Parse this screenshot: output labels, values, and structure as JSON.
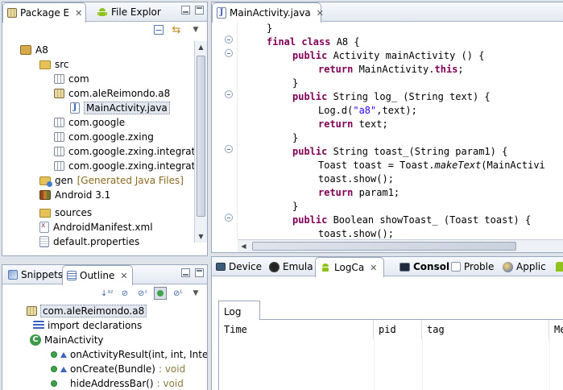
{
  "package_panel": {
    "tabs": [
      {
        "label": "Package E",
        "icon": "package-explorer-icon"
      },
      {
        "label": "File Explor",
        "icon": "android-icon"
      }
    ],
    "tree": [
      {
        "label": "A8",
        "icon": "project-icon",
        "decor": ""
      },
      {
        "label": "src",
        "icon": "source-folder-icon",
        "decor": ""
      },
      {
        "label": "com",
        "icon": "package-icon",
        "decor": ""
      },
      {
        "label": "com.aleReimondo.a8",
        "icon": "package-icon",
        "decor": ""
      },
      {
        "label": "MainActivity.java",
        "icon": "java-file-icon",
        "decor": ""
      },
      {
        "label": "com.google",
        "icon": "package-icon",
        "decor": ""
      },
      {
        "label": "com.google.zxing",
        "icon": "package-icon",
        "decor": ""
      },
      {
        "label": "com.google.zxing.integration",
        "icon": "package-icon",
        "decor": ""
      },
      {
        "label": "com.google.zxing.integration",
        "icon": "package-icon",
        "decor": ""
      },
      {
        "label": "gen",
        "icon": "generated-folder-icon",
        "decor": "[Generated Java Files]"
      },
      {
        "label": "Android 3.1",
        "icon": "library-icon",
        "decor": ""
      },
      {
        "label": "sources",
        "icon": "folder-icon",
        "decor": ""
      },
      {
        "label": "AndroidManifest.xml",
        "icon": "xml-file-icon",
        "decor": ""
      },
      {
        "label": "default.properties",
        "icon": "properties-file-icon",
        "decor": ""
      }
    ]
  },
  "editor": {
    "tab_label": "MainActivity.java",
    "lines": [
      "}",
      "final class A8 {",
      "public Activity mainActivity () {",
      "return MainActivity.this;",
      "}",
      "public String log_ (String text) {",
      "Log.d(\"a8\",text);",
      "return text;",
      "}",
      "public String toast_(String param1) {",
      "Toast toast = Toast.makeText(MainActivi",
      "toast.show();",
      "return param1;",
      "}",
      "public Boolean showToast_ (Toast toast) {",
      "toast.show();"
    ]
  },
  "outline_panel": {
    "tabs": [
      {
        "label": "Snippets"
      },
      {
        "label": "Outline"
      }
    ],
    "items": [
      {
        "label": "com.aleReimondo.a8",
        "type": ""
      },
      {
        "label": "import declarations",
        "type": ""
      },
      {
        "label": "MainActivity",
        "type": ""
      },
      {
        "label": "onActivityResult(int, int, Intent)",
        "type": ":"
      },
      {
        "label": "onCreate(Bundle)",
        "type": ": void"
      },
      {
        "label": "hideAddressBar()",
        "type": ": void"
      }
    ]
  },
  "bottom_panel": {
    "tabs": [
      {
        "label": "Device"
      },
      {
        "label": "Emula"
      },
      {
        "label": "LogCa"
      },
      {
        "label": "Consol"
      },
      {
        "label": "Proble"
      },
      {
        "label": "Applic"
      }
    ],
    "log_tab_label": "Log",
    "columns": [
      "Time",
      "pid",
      "tag",
      "Me"
    ]
  },
  "colors": {
    "keyword": "#7f0055",
    "string": "#2a00ff",
    "panel_border": "#99a8bc",
    "background": "#dfe3ea"
  }
}
